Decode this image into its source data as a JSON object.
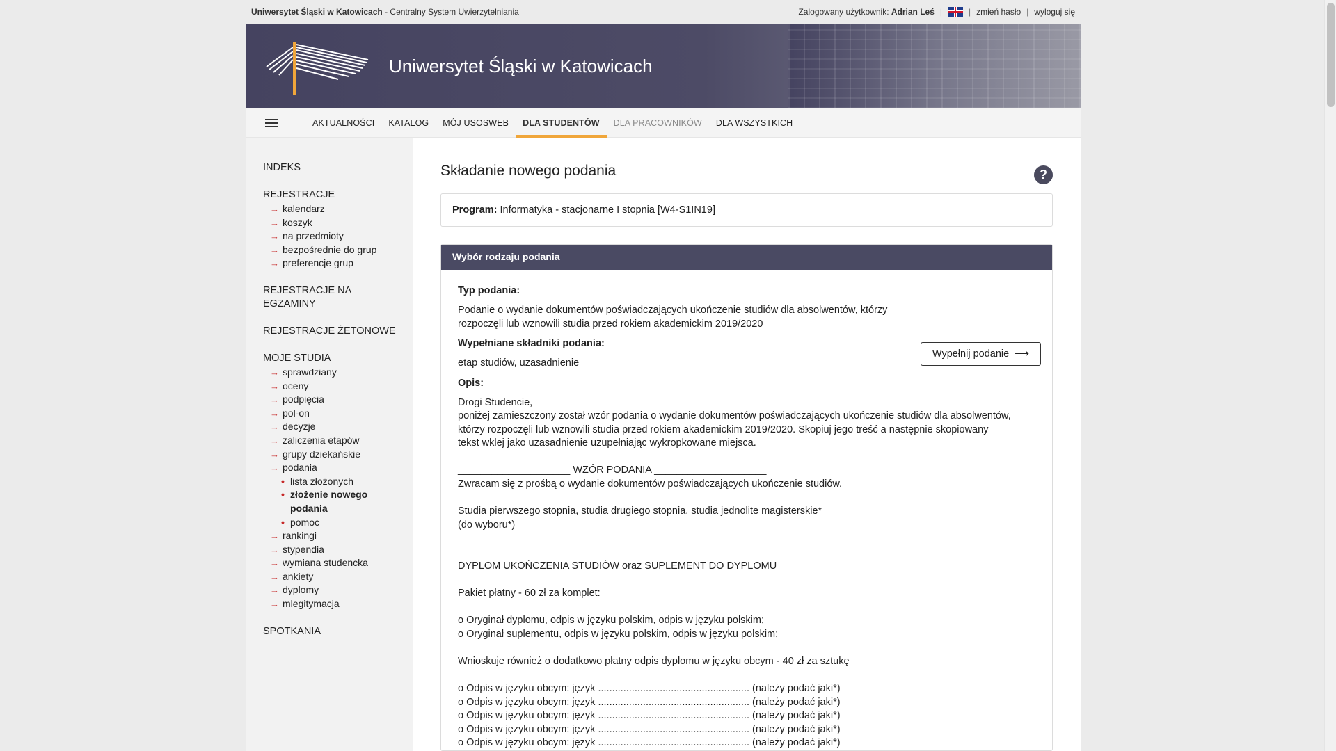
{
  "topbar": {
    "university": "Uniwersytet Śląski w Katowicach",
    "system": " - Centralny System Uwierzytelniania",
    "logged_label": "Zalogowany użytkownik:",
    "user": "Adrian Leś",
    "sep": "|",
    "change_password": "zmień hasło",
    "logout": "wyloguj się"
  },
  "banner": {
    "title": "Uniwersytet Śląski w Katowicach"
  },
  "nav": {
    "items": [
      "AKTUALNOŚCI",
      "KATALOG",
      "MÓJ USOSWEB",
      "DLA STUDENTÓW",
      "DLA PRACOWNIKÓW",
      "DLA WSZYSTKICH"
    ]
  },
  "sidebar": {
    "indeks": "INDEKS",
    "rejestracje": "REJESTRACJE",
    "rejestracje_items": [
      "kalendarz",
      "koszyk",
      "na przedmioty",
      "bezpośrednie do grup",
      "preferencje grup"
    ],
    "rejestracje_egz": "REJESTRACJE NA EGZAMINY",
    "rejestracje_zet": "REJESTRACJE ŻETONOWE",
    "moje_studia": "MOJE STUDIA",
    "moje_items_a": [
      "sprawdziany",
      "oceny",
      "podpięcia",
      "pol-on",
      "decyzje",
      "zaliczenia etapów",
      "grupy dziekańskie",
      "podania"
    ],
    "podania_items": [
      "lista złożonych",
      "złożenie nowego podania",
      "pomoc"
    ],
    "moje_items_b": [
      "rankingi",
      "stypendia",
      "wymiana studencka",
      "ankiety",
      "dyplomy",
      "mlegitymacja"
    ],
    "spotkania": "SPOTKANIA",
    "arrow": "→",
    "bullet": "•"
  },
  "main": {
    "title": "Składanie nowego podania",
    "help": "?",
    "program_label": "Program:",
    "program_value": " Informatyka - stacjonarne I stopnia [W4-S1IN19]",
    "panel_title": "Wybór rodzaju podania",
    "typ_label": "Typ podania:",
    "typ_value": "Podanie o wydanie dokumentów poświadczających ukończenie studiów dla absolwentów, którzy rozpoczęli lub wznowili studia przed rokiem akademickim 2019/2020",
    "skladniki_label": "Wypełniane składniki podania:",
    "skladniki_value": "etap studiów,  uzasadnienie",
    "opis_label": "Opis:",
    "fill_button": "Wypełnij podanie",
    "fill_arrow": "⟶",
    "desc_lines": [
      "Drogi Studencie,",
      "poniżej zamieszczony został wzór podania o wydanie dokumentów poświadczających ukończenie studiów dla absolwentów,",
      "którzy rozpoczęli lub wznowili studia przed rokiem akademickim 2019/2020. Skopiuj jego treść a następnie skopiowany",
      "tekst wklej jako uzasadnienie uzupełniając wykropkowane miejsca.",
      "",
      "____________________ WZÓR PODANIA ____________________",
      "Zwracam się z prośbą o wydanie dokumentów poświadczających ukończenie studiów.",
      "",
      "Studia pierwszego stopnia, studia drugiego stopnia, studia jednolite magisterskie*",
      "(do wyboru*)",
      "",
      "",
      "DYPLOM UKOŃCZENIA STUDIÓW oraz SUPLEMENT DO DYPLOMU",
      "",
      "Pakiet płatny - 60 zł za komplet:",
      "",
      "o Oryginał dyplomu, odpis w języku polskim, odpis w języku polskim;",
      "o Oryginał suplementu, odpis w języku polskim, odpis w języku polskim;",
      "",
      "Wnioskuje również o dodatkowo płatny odpis dyplomu w języku obcym - 40 zł za sztukę",
      "",
      "o Odpis w języku obcym: język ...................................................... (należy podać jaki*)",
      "o Odpis w języku obcym: język ...................................................... (należy podać jaki*)",
      "o Odpis w języku obcym: język ...................................................... (należy podać jaki*)",
      "o Odpis w języku obcym: język ...................................................... (należy podać jaki*)",
      "o Odpis w języku obcym: język ...................................................... (należy podać jaki*)"
    ]
  }
}
